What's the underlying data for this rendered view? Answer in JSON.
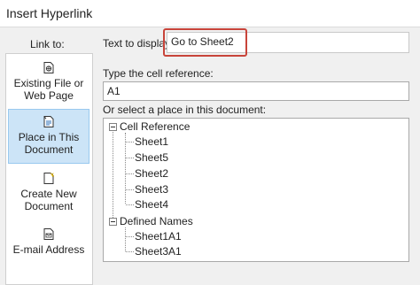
{
  "window": {
    "title": "Insert Hyperlink"
  },
  "sidebar": {
    "heading": "Link to:",
    "items": [
      {
        "label": "Existing File or\nWeb Page",
        "icon": "globe-file-icon",
        "selected": false
      },
      {
        "label": "Place in This\nDocument",
        "icon": "document-place-icon",
        "selected": true
      },
      {
        "label": "Create New\nDocument",
        "icon": "new-document-icon",
        "selected": false
      },
      {
        "label": "E-mail Address",
        "icon": "email-icon",
        "selected": false
      }
    ]
  },
  "form": {
    "display_label": "Text to display:",
    "display_value": "Go to Sheet2",
    "cell_ref_label": "Type the cell reference:",
    "cell_ref_value": "A1",
    "place_label": "Or select a place in this document:"
  },
  "tree": {
    "groups": [
      {
        "label": "Cell Reference",
        "children": [
          "Sheet1",
          "Sheet5",
          "Sheet2",
          "Sheet3",
          "Sheet4"
        ]
      },
      {
        "label": "Defined Names",
        "children": [
          "Sheet1A1",
          "Sheet3A1"
        ]
      }
    ]
  },
  "colors": {
    "selected_bg": "#cce4f7",
    "highlight_border": "#c8443a"
  }
}
